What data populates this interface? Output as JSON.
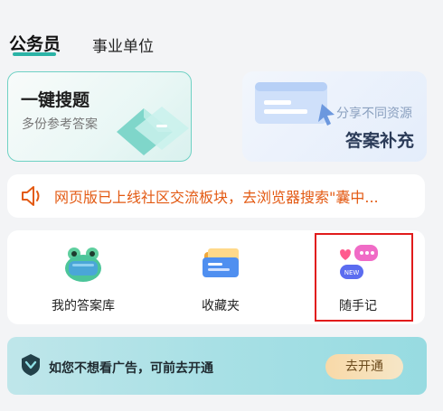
{
  "tabs": [
    {
      "label": "公务员"
    },
    {
      "label": "事业单位"
    }
  ],
  "promo_cards": {
    "left": {
      "title": "一键搜题",
      "subtitle": "多份参考答案"
    },
    "right": {
      "subtitle": "分享不同资源",
      "title": "答案补充"
    }
  },
  "notice": {
    "text": "网页版已上线社区交流板块，去浏览器搜索\"囊中..."
  },
  "quick_links": [
    {
      "label": "我的答案库",
      "icon": "frog-mascot-icon"
    },
    {
      "label": "收藏夹",
      "icon": "folder-icon"
    },
    {
      "label": "随手记",
      "icon": "note-bubble-icon"
    }
  ],
  "ad_banner": {
    "text": "如您不想看广告，可前去开通",
    "button": "去开通"
  },
  "colors": {
    "accent": "#2bb3a6",
    "notice": "#e35a13",
    "highlight": "#e11b1b"
  }
}
